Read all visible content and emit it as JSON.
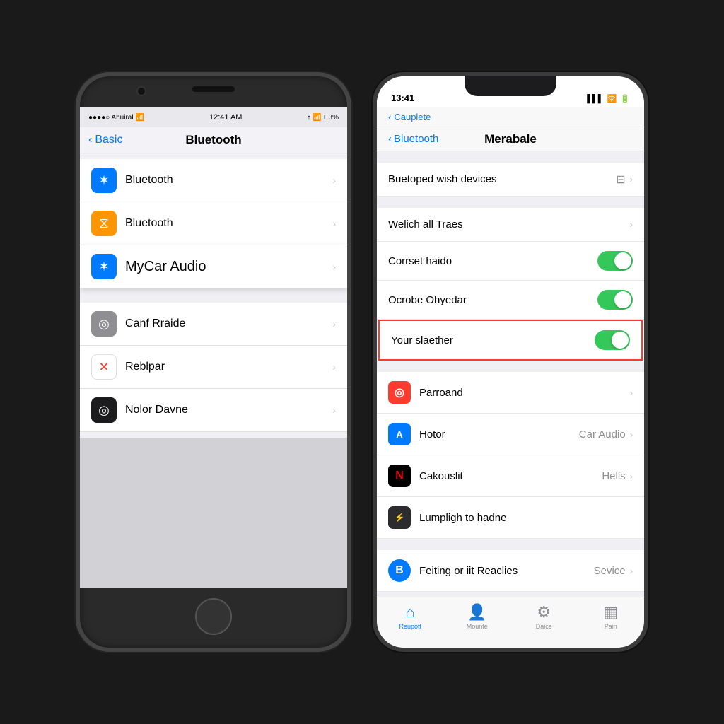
{
  "left_phone": {
    "status_bar": {
      "carrier": "●●●●○ Ahuiral",
      "wifi": "▾",
      "time": "12:41 AM",
      "location": "↑",
      "battery": "E3%"
    },
    "nav": {
      "back_label": "Basic",
      "title": "Bluetooth"
    },
    "rows": [
      {
        "icon_type": "blue",
        "icon_char": "✶",
        "label": "Bluetooth",
        "highlighted": false
      },
      {
        "icon_type": "yellow",
        "icon_char": "⧖",
        "label": "Bluetooth",
        "highlighted": false
      },
      {
        "icon_type": "blue",
        "icon_char": "✶",
        "label": "MyCar Audio",
        "highlighted": true
      },
      {
        "icon_type": "gray",
        "icon_char": "◎",
        "label": "Canf Rraide",
        "highlighted": false
      },
      {
        "icon_type": "red_x",
        "icon_char": "✕",
        "label": "Reblpar",
        "highlighted": false
      },
      {
        "icon_type": "black",
        "icon_char": "◎",
        "label": "Nolor Davne",
        "highlighted": false
      }
    ]
  },
  "right_phone": {
    "status_bar": {
      "time": "13:41",
      "signal": "▌▌▌",
      "wifi": "⊘",
      "battery": "▭"
    },
    "sub_nav": {
      "back_label": "Cauplete"
    },
    "nav": {
      "back_label": "Bluetooth",
      "title": "Merabale"
    },
    "top_section": {
      "label": "Buetoped wish devices",
      "icon": "⊟"
    },
    "settings_rows": [
      {
        "label": "Welich all Traes",
        "type": "chevron",
        "value": ""
      },
      {
        "label": "Corrset haido",
        "type": "toggle"
      },
      {
        "label": "Ocrobe Ohyedar",
        "type": "toggle"
      },
      {
        "label": "Your slaether",
        "type": "toggle",
        "highlighted": true
      }
    ],
    "app_rows": [
      {
        "icon_type": "red_bg",
        "icon_char": "◎",
        "label": "Parroand",
        "type": "chevron",
        "value": ""
      },
      {
        "icon_type": "blue_bg",
        "icon_char": "A",
        "label": "Hotor",
        "type": "chevron",
        "value": "Car Audio"
      },
      {
        "icon_type": "netflix",
        "icon_char": "N",
        "label": "Cakouslit",
        "type": "chevron",
        "value": "Hells"
      },
      {
        "icon_type": "dark",
        "icon_char": "⚡",
        "label": "Lumpligh to hadne",
        "type": "none",
        "value": ""
      }
    ],
    "bottom_row": {
      "icon_type": "blue_circle",
      "icon_char": "B",
      "label": "Feiting or iit Reaclies",
      "value": "Sevice"
    },
    "tab_bar": {
      "tabs": [
        {
          "icon": "⌂",
          "label": "Reupott",
          "active": true
        },
        {
          "icon": "👤",
          "label": "Mounte",
          "active": false
        },
        {
          "icon": "⚙",
          "label": "Daice",
          "active": false
        },
        {
          "icon": "▦",
          "label": "Pain",
          "active": false
        }
      ]
    }
  }
}
